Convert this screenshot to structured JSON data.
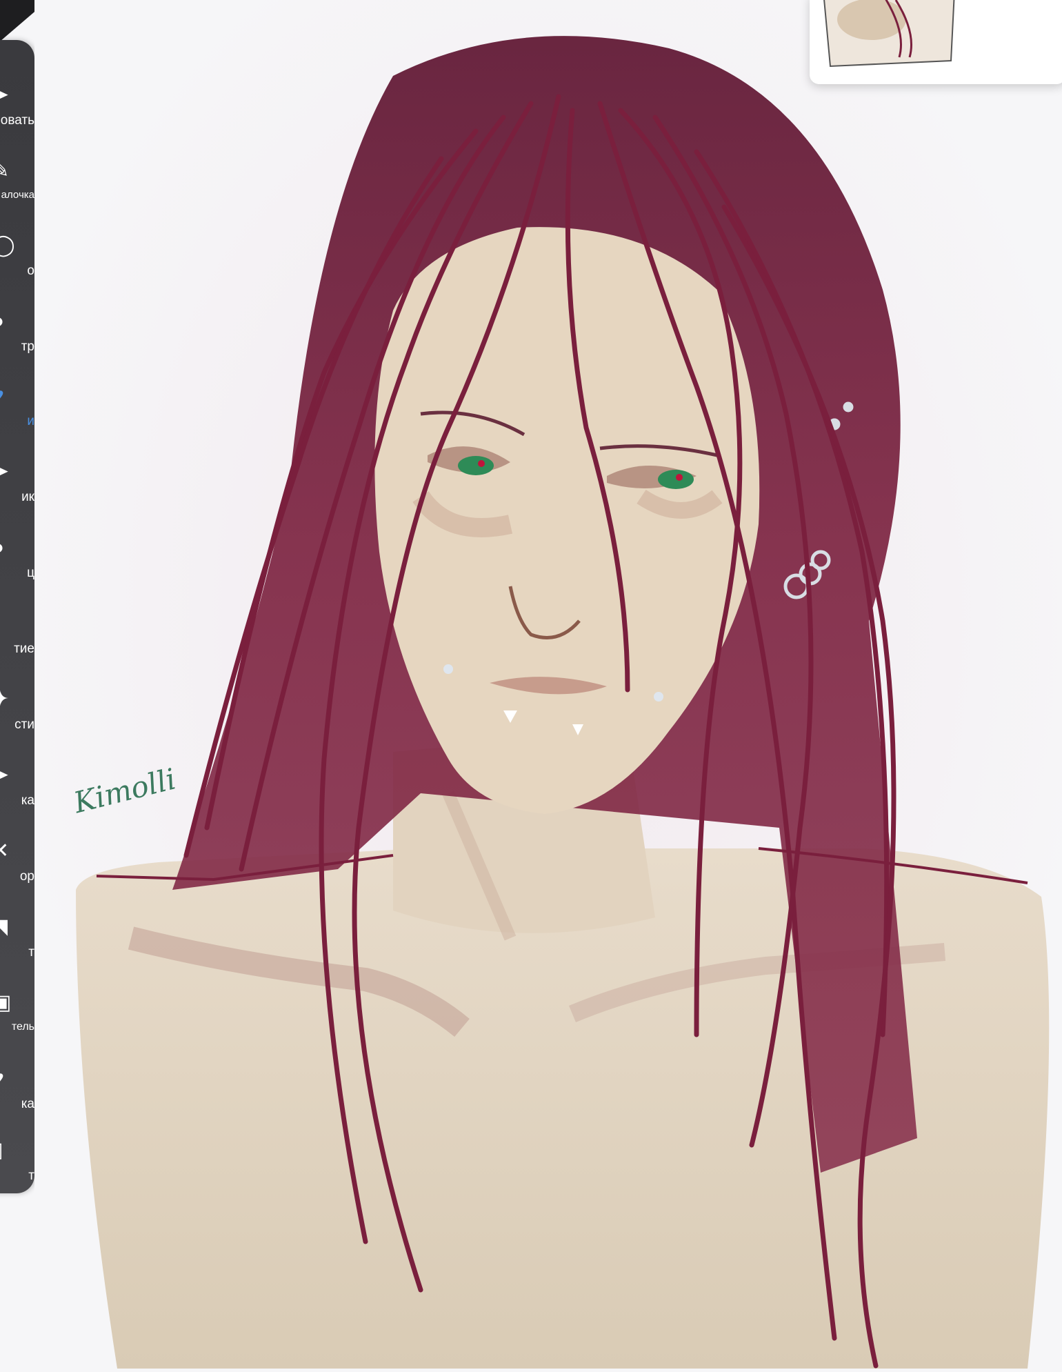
{
  "tools": [
    {
      "label": "овать",
      "icon": "arrow-icon"
    },
    {
      "label": "алочка",
      "icon": "wand-icon"
    },
    {
      "label": "о",
      "icon": "lasso-icon"
    },
    {
      "label": "тр",
      "icon": "filter-icon"
    },
    {
      "label": "и",
      "icon": "brush-icon",
      "active": true
    },
    {
      "label": "ик",
      "icon": "smudge-icon"
    },
    {
      "label": "ц",
      "icon": "drop-icon"
    },
    {
      "label": "тие",
      "icon": "blur-icon"
    },
    {
      "label": "сти",
      "icon": "sparkle-icon"
    },
    {
      "label": "ка",
      "icon": "fill-icon"
    },
    {
      "label": "ор",
      "icon": "text-icon"
    },
    {
      "label": "т",
      "icon": "frame-icon"
    },
    {
      "label": "тель",
      "icon": "divider-icon"
    },
    {
      "label": "ка",
      "icon": "eyedropper-icon"
    },
    {
      "label": "т",
      "icon": "canvas-icon"
    }
  ],
  "artwork": {
    "signature": "Kimolli"
  },
  "colors": {
    "hair": "#7a1f3d",
    "hair_dark": "#4a0f24",
    "skin": "#e2d6c3",
    "skin_shadow": "#c7a996",
    "eyes": "#2e8b57",
    "signature": "#3c7a5f",
    "toolbar_bg": "#3a3a3e",
    "active_tool": "#4a90e2"
  }
}
